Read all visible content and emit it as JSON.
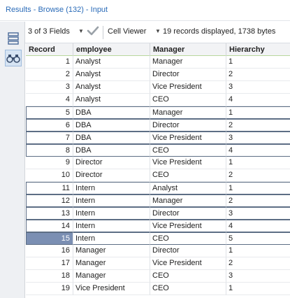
{
  "window": {
    "title": "Results - Browse (132) - Input"
  },
  "sidebar": {
    "icons": [
      "list-view-icon",
      "binoculars-icon"
    ]
  },
  "toolbar": {
    "fields_label": "3 of 3 Fields",
    "viewer_label": "Cell Viewer",
    "records_status": "19 records displayed, 1738 bytes"
  },
  "colors": {
    "accent": "#2a6bb8",
    "header_underline": "#b8d79d",
    "selected_record": "#7b8fb3"
  },
  "table": {
    "columns": [
      "Record",
      "employee",
      "Manager",
      "Hierarchy"
    ],
    "selected_record": "15",
    "rows": [
      [
        "1",
        "Analyst",
        "Manager",
        "1"
      ],
      [
        "2",
        "Analyst",
        "Director",
        "2"
      ],
      [
        "3",
        "Analyst",
        "Vice President",
        "3"
      ],
      [
        "4",
        "Analyst",
        "CEO",
        "4"
      ],
      [
        "5",
        "DBA",
        "Manager",
        "1"
      ],
      [
        "6",
        "DBA",
        "Director",
        "2"
      ],
      [
        "7",
        "DBA",
        "Vice President",
        "3"
      ],
      [
        "8",
        "DBA",
        "CEO",
        "4"
      ],
      [
        "9",
        "Director",
        "Vice President",
        "1"
      ],
      [
        "10",
        "Director",
        "CEO",
        "2"
      ],
      [
        "11",
        "Intern",
        "Analyst",
        "1"
      ],
      [
        "12",
        "Intern",
        "Manager",
        "2"
      ],
      [
        "13",
        "Intern",
        "Director",
        "3"
      ],
      [
        "14",
        "Intern",
        "Vice President",
        "4"
      ],
      [
        "15",
        "Intern",
        "CEO",
        "5"
      ],
      [
        "16",
        "Manager",
        "Director",
        "1"
      ],
      [
        "17",
        "Manager",
        "Vice President",
        "2"
      ],
      [
        "18",
        "Manager",
        "CEO",
        "3"
      ],
      [
        "19",
        "Vice President",
        "CEO",
        "1"
      ]
    ]
  }
}
